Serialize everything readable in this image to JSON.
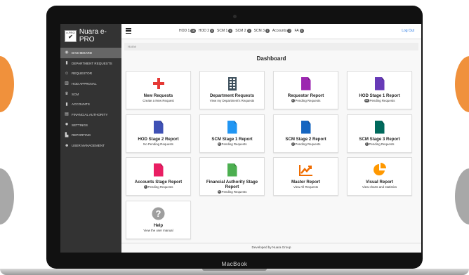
{
  "app": {
    "title": "Nuara e-PRO",
    "logo_top": "e-PRO",
    "device_label": "MacBook"
  },
  "topbar": {
    "links": [
      {
        "label": "HOD 1",
        "count": "16"
      },
      {
        "label": "HOD 2",
        "count": "0"
      },
      {
        "label": "SCM 1",
        "count": "6"
      },
      {
        "label": "SCM 2",
        "count": "3"
      },
      {
        "label": "SCM 3",
        "count": "3"
      },
      {
        "label": "Accounts",
        "count": "2"
      },
      {
        "label": "FA",
        "count": "5"
      }
    ],
    "logout": "Log Out"
  },
  "sidebar": {
    "items": [
      {
        "label": "DASHBOARD",
        "icon": "dashboard-icon",
        "active": true
      },
      {
        "label": "DEPARTMENT REQUESTS",
        "icon": "file-icon"
      },
      {
        "label": "REQUESTOR",
        "icon": "user-plus-icon"
      },
      {
        "label": "HOD APPROVAL",
        "icon": "building-icon"
      },
      {
        "label": "SCM",
        "icon": "trophy-icon"
      },
      {
        "label": "ACCOUNTS",
        "icon": "file-icon"
      },
      {
        "label": "FINANCIAL AUTHORITY",
        "icon": "money-icon"
      },
      {
        "label": "SETTINGS",
        "icon": "gear-icon"
      },
      {
        "label": "REPORTING",
        "icon": "chart-icon"
      },
      {
        "label": "USER MANAGEMENT",
        "icon": "users-icon"
      }
    ]
  },
  "main": {
    "breadcrumb": "Home",
    "title": "Dashboard",
    "cards": [
      {
        "title": "New Requests",
        "subtitle": "Create a New Request",
        "icon": "plus-icon",
        "color": "#e53935"
      },
      {
        "title": "Department Requests",
        "subtitle": "View my Department's Requests",
        "icon": "building-icon",
        "color": "#3d4f5c"
      },
      {
        "title": "Requestor Report",
        "badge": "2",
        "subtitle": "Pending Requests",
        "icon": "document-icon",
        "color": "#9c27b0"
      },
      {
        "title": "HOD Stage 1 Report",
        "badge": "16",
        "subtitle": "Pending Requests",
        "icon": "document-icon",
        "color": "#673ab7"
      },
      {
        "title": "HOD Stage 2 Report",
        "subtitle": "No Pending Requests",
        "icon": "document-icon",
        "color": "#3f51b5"
      },
      {
        "title": "SCM Stage 1 Report",
        "badge": "6",
        "subtitle": "Pending Requests",
        "icon": "document-icon",
        "color": "#2196f3"
      },
      {
        "title": "SCM Stage 2 Report",
        "badge": "3",
        "subtitle": "Pending Requests",
        "icon": "document-icon",
        "color": "#1565c0"
      },
      {
        "title": "SCM Stage 3 Report",
        "badge": "3",
        "subtitle": "Pending Requests",
        "icon": "document-icon",
        "color": "#00695c"
      },
      {
        "title": "Accounts Stage Report",
        "badge": "2",
        "subtitle": "Pending Requests",
        "icon": "document-icon",
        "color": "#e91e63"
      },
      {
        "title": "Financial Authority Stage Report",
        "badge": "5",
        "subtitle": "Pending Requests",
        "icon": "document-icon",
        "color": "#4caf50"
      },
      {
        "title": "Master Report",
        "subtitle": "View All Requests",
        "icon": "trend-chart-icon",
        "color": "#ef6c00"
      },
      {
        "title": "Visual Report",
        "subtitle": "View charts and statistics",
        "icon": "pie-chart-icon",
        "color": "#ff9800"
      },
      {
        "title": "Help",
        "subtitle": "View the user manual",
        "icon": "help-icon",
        "color": "#9e9e9e"
      }
    ],
    "footer": "Developed by Nuara Group"
  }
}
